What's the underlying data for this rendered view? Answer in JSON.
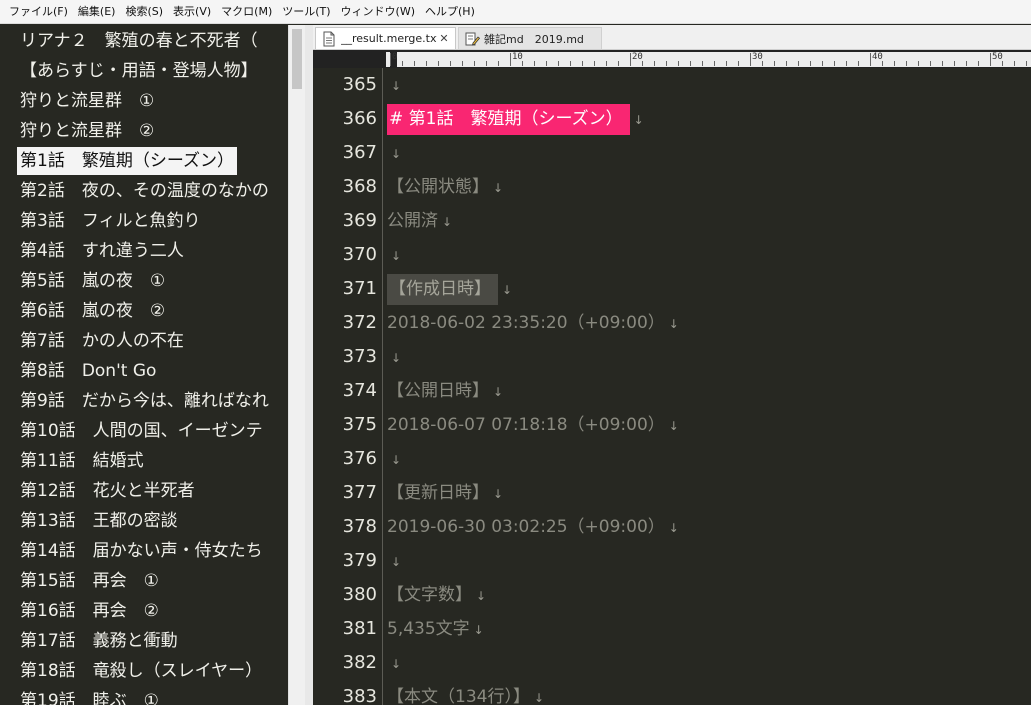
{
  "menu": [
    "ファイル(F)",
    "編集(E)",
    "検索(S)",
    "表示(V)",
    "マクロ(M)",
    "ツール(T)",
    "ウィンドウ(W)",
    "ヘルプ(H)"
  ],
  "outline": {
    "items": [
      "リアナ２　繁殖の春と不死者（",
      "【あらすじ・用語・登場人物】",
      "狩りと流星群　①",
      "狩りと流星群　②",
      "第1話　繁殖期（シーズン）",
      "第2話　夜の、その温度のなかの",
      "第3話　フィルと魚釣り",
      "第4話　すれ違う二人",
      "第5話　嵐の夜　①",
      "第6話　嵐の夜　②",
      "第7話　かの人の不在",
      "第8話　Don't Go",
      "第9話　だから今は、離ればなれ",
      "第10話　人間の国、イーゼンテ",
      "第11話　結婚式",
      "第12話　花火と半死者",
      "第13話　王都の密談",
      "第14話　届かない声・侍女たち",
      "第15話　再会　①",
      "第16話　再会　②",
      "第17話　義務と衝動",
      "第18話　竜殺し（スレイヤー）",
      "第19話　睦ぶ　①"
    ],
    "selected_index": 4
  },
  "tabs": [
    {
      "label": "__result.merge.txt",
      "close": "✕",
      "icon": "text-file-icon",
      "active": true
    },
    {
      "label": "雑記md　2019.md",
      "icon": "note-edit-icon",
      "active": false
    }
  ],
  "ruler": {
    "labels": [
      "0",
      "10",
      "20",
      "30",
      "40",
      "50"
    ]
  },
  "eol_mark": "↓",
  "editor": {
    "lines": [
      {
        "num": "365",
        "text": ""
      },
      {
        "num": "366",
        "text": "# 第1話　繁殖期（シーズン）",
        "style": "heading"
      },
      {
        "num": "367",
        "text": ""
      },
      {
        "num": "368",
        "text": "【公開状態】"
      },
      {
        "num": "369",
        "text": "公開済"
      },
      {
        "num": "370",
        "text": ""
      },
      {
        "num": "371",
        "text": "【作成日時】",
        "style": "cursorline"
      },
      {
        "num": "372",
        "text": "2018-06-02 23:35:20（+09:00）"
      },
      {
        "num": "373",
        "text": ""
      },
      {
        "num": "374",
        "text": "【公開日時】"
      },
      {
        "num": "375",
        "text": "2018-06-07 07:18:18（+09:00）"
      },
      {
        "num": "376",
        "text": ""
      },
      {
        "num": "377",
        "text": "【更新日時】"
      },
      {
        "num": "378",
        "text": "2019-06-30 03:02:25（+09:00）"
      },
      {
        "num": "379",
        "text": ""
      },
      {
        "num": "380",
        "text": "【文字数】"
      },
      {
        "num": "381",
        "text": "5,435文字"
      },
      {
        "num": "382",
        "text": ""
      },
      {
        "num": "383",
        "text": "【本文（134行）】"
      }
    ]
  },
  "colors": {
    "background": "#272822",
    "heading_highlight": "#f92672",
    "text_dim": "#8a8a80",
    "line_number": "#e6e6de"
  }
}
